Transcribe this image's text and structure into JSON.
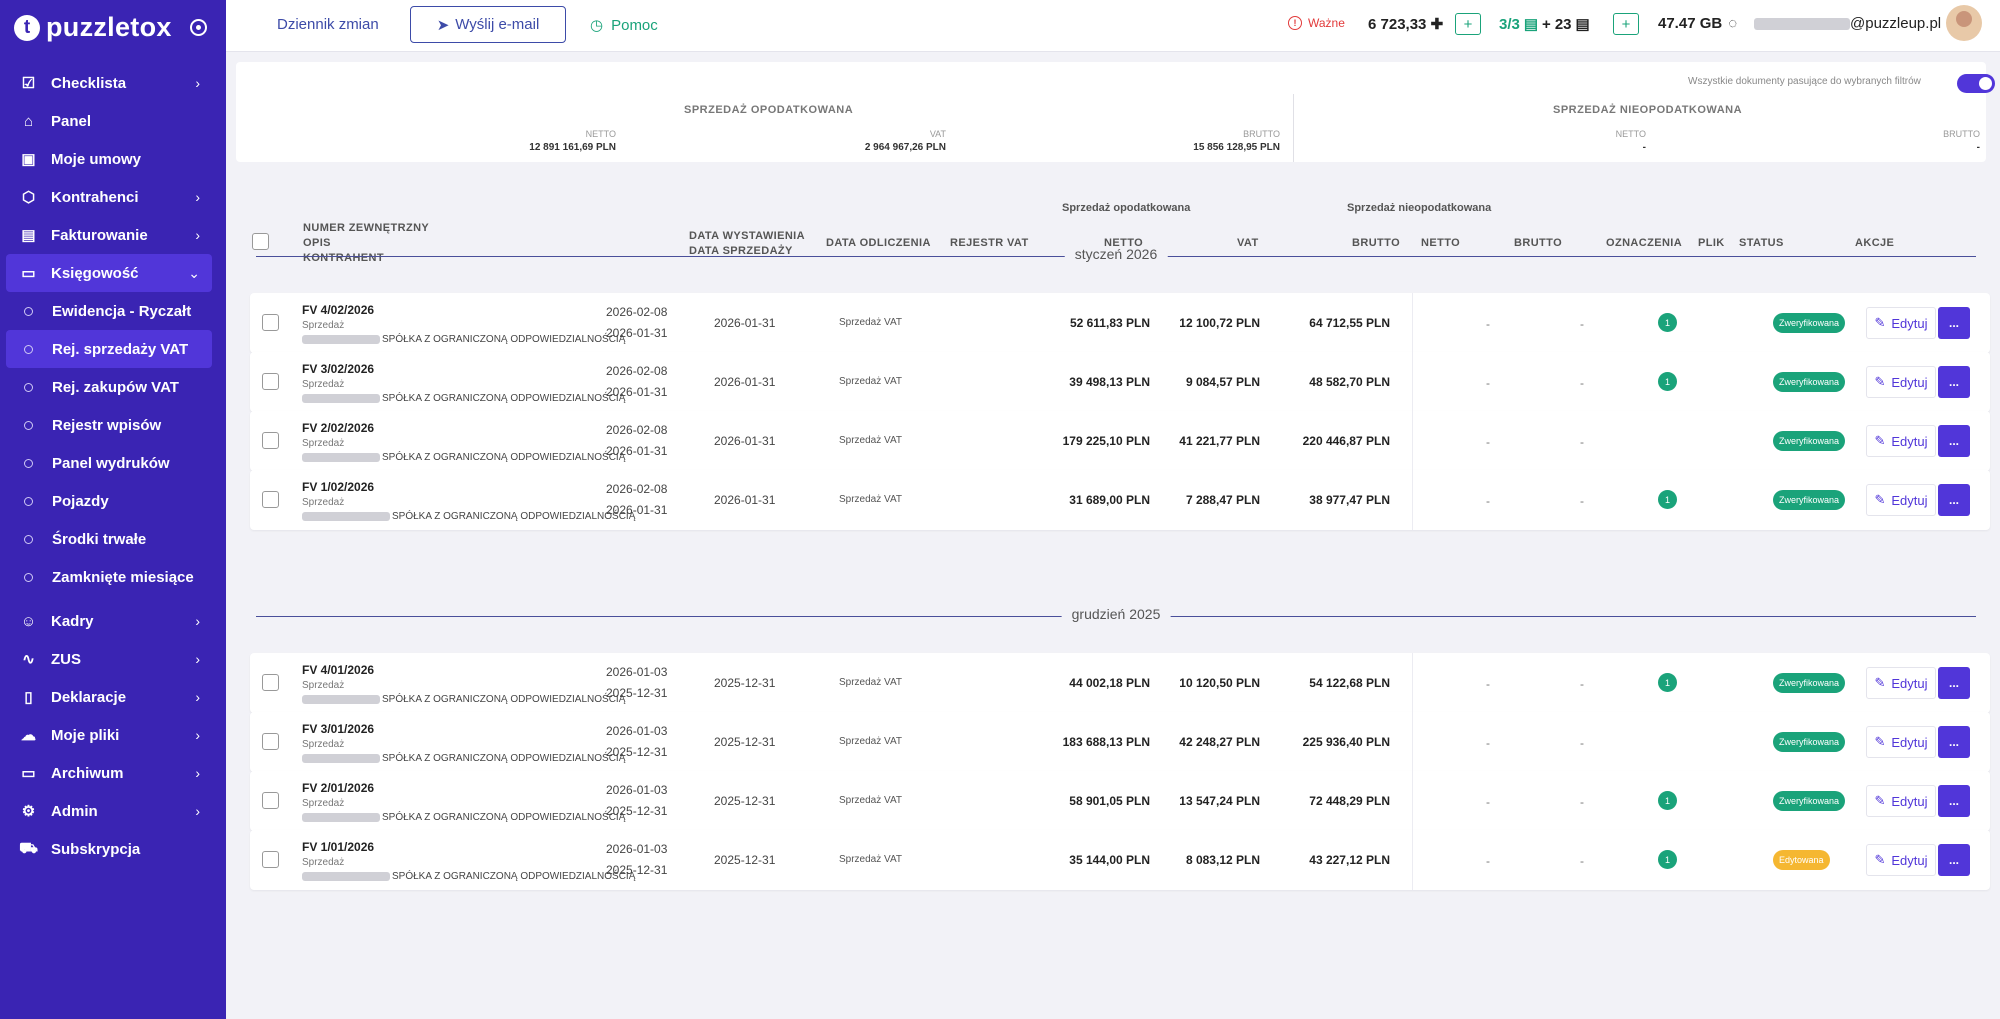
{
  "app": {
    "name": "puzzletox",
    "logo_letter": "t"
  },
  "sidebar": {
    "items": [
      {
        "label": "Checklista",
        "icon": "checkbox-icon",
        "chevron": true
      },
      {
        "label": "Panel",
        "icon": "home-icon",
        "chevron": false
      },
      {
        "label": "Moje umowy",
        "icon": "briefcase-icon",
        "chevron": false
      },
      {
        "label": "Kontrahenci",
        "icon": "box-icon",
        "chevron": true
      },
      {
        "label": "Fakturowanie",
        "icon": "invoice-icon",
        "chevron": true
      },
      {
        "label": "Księgowość",
        "icon": "archive-icon",
        "chevron": true,
        "active": true
      }
    ],
    "subitems": [
      {
        "label": "Ewidencja - Ryczałt"
      },
      {
        "label": "Rej. sprzedaży VAT",
        "active": true
      },
      {
        "label": "Rej. zakupów VAT"
      },
      {
        "label": "Rejestr wpisów"
      },
      {
        "label": "Panel wydruków"
      },
      {
        "label": "Pojazdy"
      },
      {
        "label": "Środki trwałe"
      },
      {
        "label": "Zamknięte miesiące"
      }
    ],
    "items_bottom": [
      {
        "label": "Kadry",
        "icon": "users-icon",
        "chevron": true
      },
      {
        "label": "ZUS",
        "icon": "activity-icon",
        "chevron": true
      },
      {
        "label": "Deklaracje",
        "icon": "book-icon",
        "chevron": true
      },
      {
        "label": "Moje pliki",
        "icon": "cloud-upload-icon",
        "chevron": true
      },
      {
        "label": "Archiwum",
        "icon": "archive-icon",
        "chevron": true
      },
      {
        "label": "Admin",
        "icon": "gear-icon",
        "chevron": true
      },
      {
        "label": "Subskrypcja",
        "icon": "cart-icon",
        "chevron": false
      }
    ]
  },
  "topbar": {
    "changelog": "Dziennik zmian",
    "send_email": "Wyślij e-mail",
    "help": "Pomoc",
    "important": "Ważne",
    "points": "6 723,33",
    "docs_ratio": "3/3",
    "docs_plus": "+",
    "docs_count": "23",
    "plus_label": "+",
    "disk": "47.47 GB",
    "email_domain": "@puzzleup.pl"
  },
  "summary": {
    "taxable_title": "SPRZEDAŻ OPODATKOWANA",
    "nontaxable_title": "SPRZEDAŻ NIEOPODATKOWANA",
    "toggle_label": "Wszystkie dokumenty pasujące do wybranych filtrów",
    "netto_label": "NETTO",
    "vat_label": "VAT",
    "brutto_label": "BRUTTO",
    "taxable_netto": "12 891 161,69 PLN",
    "taxable_vat": "2 964 967,26 PLN",
    "taxable_brutto": "15 856 128,95 PLN",
    "nontaxable_netto": "-",
    "nontaxable_brutto": "-"
  },
  "table_header": {
    "group_taxable": "Sprzedaż opodatkowana",
    "group_nontaxable": "Sprzedaż nieopodatkowana",
    "num": "NUMER ZEWNĘTRZNY",
    "opis": "OPIS",
    "kontrahent": "KONTRAHENT",
    "date_issue": "DATA WYSTAWIENIA",
    "date_sale": "DATA SPRZEDAŻY",
    "date_deduct": "DATA ODLICZENIA",
    "register": "REJESTR VAT",
    "netto": "NETTO",
    "vat": "VAT",
    "brutto": "BRUTTO",
    "netto2": "NETTO",
    "brutto2": "BRUTTO",
    "marks": "OZNACZENIA",
    "file": "PLIK",
    "status": "STATUS",
    "actions": "AKCJE"
  },
  "groups": [
    {
      "label": "styczeń 2026"
    },
    {
      "label": "grudzień 2025"
    }
  ],
  "colors": {
    "accent": "#3a24b3",
    "green": "#1aa37a",
    "orange": "#f5b731"
  },
  "rows": [
    {
      "num": "FV 4/02/2026",
      "opis": "Sprzedaż",
      "kontr": "SPÓŁKA Z OGRANICZONĄ ODPOWIEDZIALNOŚCIĄ",
      "d1": "2026-02-08",
      "d2": "2026-01-31",
      "dodl": "2026-01-31",
      "rej": "Sprzedaż VAT",
      "netto": "52 611,83 PLN",
      "vat": "12 100,72 PLN",
      "brutto": "64 712,55 PLN",
      "dash": "-",
      "mark": "1",
      "status": "Zweryfikowana",
      "status_color": "#1aa37a",
      "edit": "Edytuj",
      "more": "..."
    },
    {
      "num": "FV 3/02/2026",
      "opis": "Sprzedaż",
      "kontr": "SPÓŁKA Z OGRANICZONĄ ODPOWIEDZIALNOŚCIĄ",
      "d1": "2026-02-08",
      "d2": "2026-01-31",
      "dodl": "2026-01-31",
      "rej": "Sprzedaż VAT",
      "netto": "39 498,13 PLN",
      "vat": "9 084,57 PLN",
      "brutto": "48 582,70 PLN",
      "dash": "-",
      "mark": "1",
      "status": "Zweryfikowana",
      "status_color": "#1aa37a",
      "edit": "Edytuj",
      "more": "..."
    },
    {
      "num": "FV 2/02/2026",
      "opis": "Sprzedaż",
      "kontr": "SPÓŁKA Z OGRANICZONĄ ODPOWIEDZIALNOŚCIĄ",
      "d1": "2026-02-08",
      "d2": "2026-01-31",
      "dodl": "2026-01-31",
      "rej": "Sprzedaż VAT",
      "netto": "179 225,10 PLN",
      "vat": "41 221,77 PLN",
      "brutto": "220 446,87 PLN",
      "dash": "-",
      "mark": "",
      "status": "Zweryfikowana",
      "status_color": "#1aa37a",
      "edit": "Edytuj",
      "more": "..."
    },
    {
      "num": "FV 1/02/2026",
      "opis": "Sprzedaż",
      "kontr": "SPÓŁKA Z OGRANICZONĄ ODPOWIEDZIALNOŚCIĄ",
      "d1": "2026-02-08",
      "d2": "2026-01-31",
      "dodl": "2026-01-31",
      "rej": "Sprzedaż VAT",
      "netto": "31 689,00 PLN",
      "vat": "7 288,47 PLN",
      "brutto": "38 977,47 PLN",
      "dash": "-",
      "mark": "1",
      "status": "Zweryfikowana",
      "status_color": "#1aa37a",
      "edit": "Edytuj",
      "more": "..."
    },
    {
      "num": "FV 4/01/2026",
      "opis": "Sprzedaż",
      "kontr": "SPÓŁKA Z OGRANICZONĄ ODPOWIEDZIALNOŚCIĄ",
      "d1": "2026-01-03",
      "d2": "2025-12-31",
      "dodl": "2025-12-31",
      "rej": "Sprzedaż VAT",
      "netto": "44 002,18 PLN",
      "vat": "10 120,50 PLN",
      "brutto": "54 122,68 PLN",
      "dash": "-",
      "mark": "1",
      "status": "Zweryfikowana",
      "status_color": "#1aa37a",
      "edit": "Edytuj",
      "more": "..."
    },
    {
      "num": "FV 3/01/2026",
      "opis": "Sprzedaż",
      "kontr": "SPÓŁKA Z OGRANICZONĄ ODPOWIEDZIALNOŚCIĄ",
      "d1": "2026-01-03",
      "d2": "2025-12-31",
      "dodl": "2025-12-31",
      "rej": "Sprzedaż VAT",
      "netto": "183 688,13 PLN",
      "vat": "42 248,27 PLN",
      "brutto": "225 936,40 PLN",
      "dash": "-",
      "mark": "",
      "status": "Zweryfikowana",
      "status_color": "#1aa37a",
      "edit": "Edytuj",
      "more": "..."
    },
    {
      "num": "FV 2/01/2026",
      "opis": "Sprzedaż",
      "kontr": "SPÓŁKA Z OGRANICZONĄ ODPOWIEDZIALNOŚCIĄ",
      "d1": "2026-01-03",
      "d2": "2025-12-31",
      "dodl": "2025-12-31",
      "rej": "Sprzedaż VAT",
      "netto": "58 901,05 PLN",
      "vat": "13 547,24 PLN",
      "brutto": "72 448,29 PLN",
      "dash": "-",
      "mark": "1",
      "status": "Zweryfikowana",
      "status_color": "#1aa37a",
      "edit": "Edytuj",
      "more": "..."
    },
    {
      "num": "FV 1/01/2026",
      "opis": "Sprzedaż",
      "kontr": "SPÓŁKA Z OGRANICZONĄ ODPOWIEDZIALNOŚCIĄ",
      "d1": "2026-01-03",
      "d2": "2025-12-31",
      "dodl": "2025-12-31",
      "rej": "Sprzedaż VAT",
      "netto": "35 144,00 PLN",
      "vat": "8 083,12 PLN",
      "brutto": "43 227,12 PLN",
      "dash": "-",
      "mark": "1",
      "status": "Edytowana",
      "status_color": "#f5b731",
      "edit": "Edytuj",
      "more": "..."
    }
  ]
}
